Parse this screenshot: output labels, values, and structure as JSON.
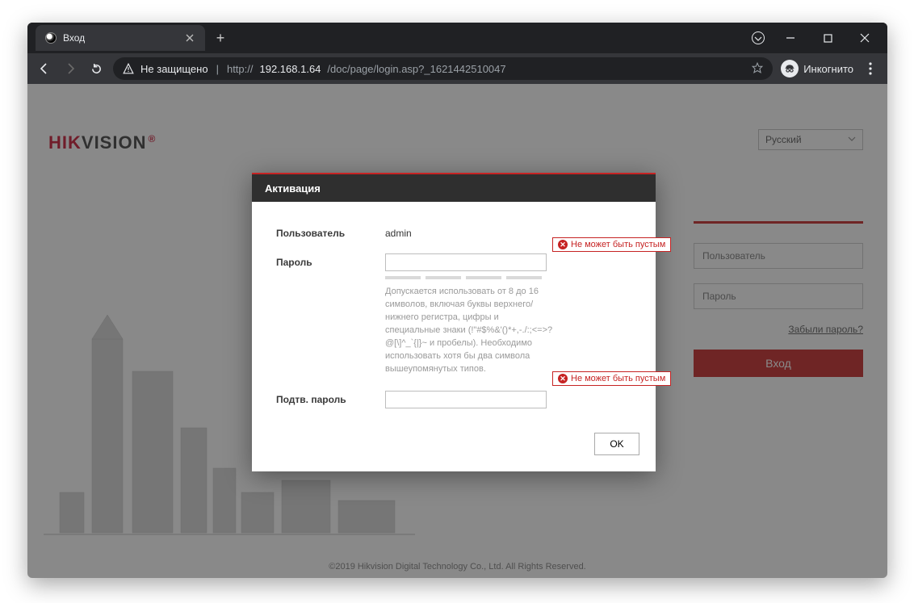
{
  "browser": {
    "tab_title": "Вход",
    "security_label": "Не защищено",
    "url_scheme": "http://",
    "url_host": "192.168.1.64",
    "url_path": "/doc/page/login.asp?_1621442510047",
    "incognito_label": "Инкогнито"
  },
  "page": {
    "brand_hik": "HIK",
    "brand_vision": "VISION",
    "brand_reg": "®",
    "language": "Русский",
    "footer": "©2019 Hikvision Digital Technology Co., Ltd. All Rights Reserved."
  },
  "login": {
    "username_placeholder": "Пользователь",
    "password_placeholder": "Пароль",
    "forgot": "Забыли пароль?",
    "login_btn": "Вход"
  },
  "modal": {
    "title": "Активация",
    "user_label": "Пользователь",
    "user_value": "admin",
    "pass_label": "Пароль",
    "confirm_label": "Подтв. пароль",
    "hint": "Допускается использовать от 8 до 16 символов, включая буквы верхнего/нижнего регистра, цифры и специальные знаки (!\"#$%&'()*+,-./:;<=>?@[\\]^_`{|}~ и пробелы). Необходимо использовать хотя бы два символа вышеупомянутых типов.",
    "error_empty": "Не может быть пустым",
    "ok": "OK"
  }
}
